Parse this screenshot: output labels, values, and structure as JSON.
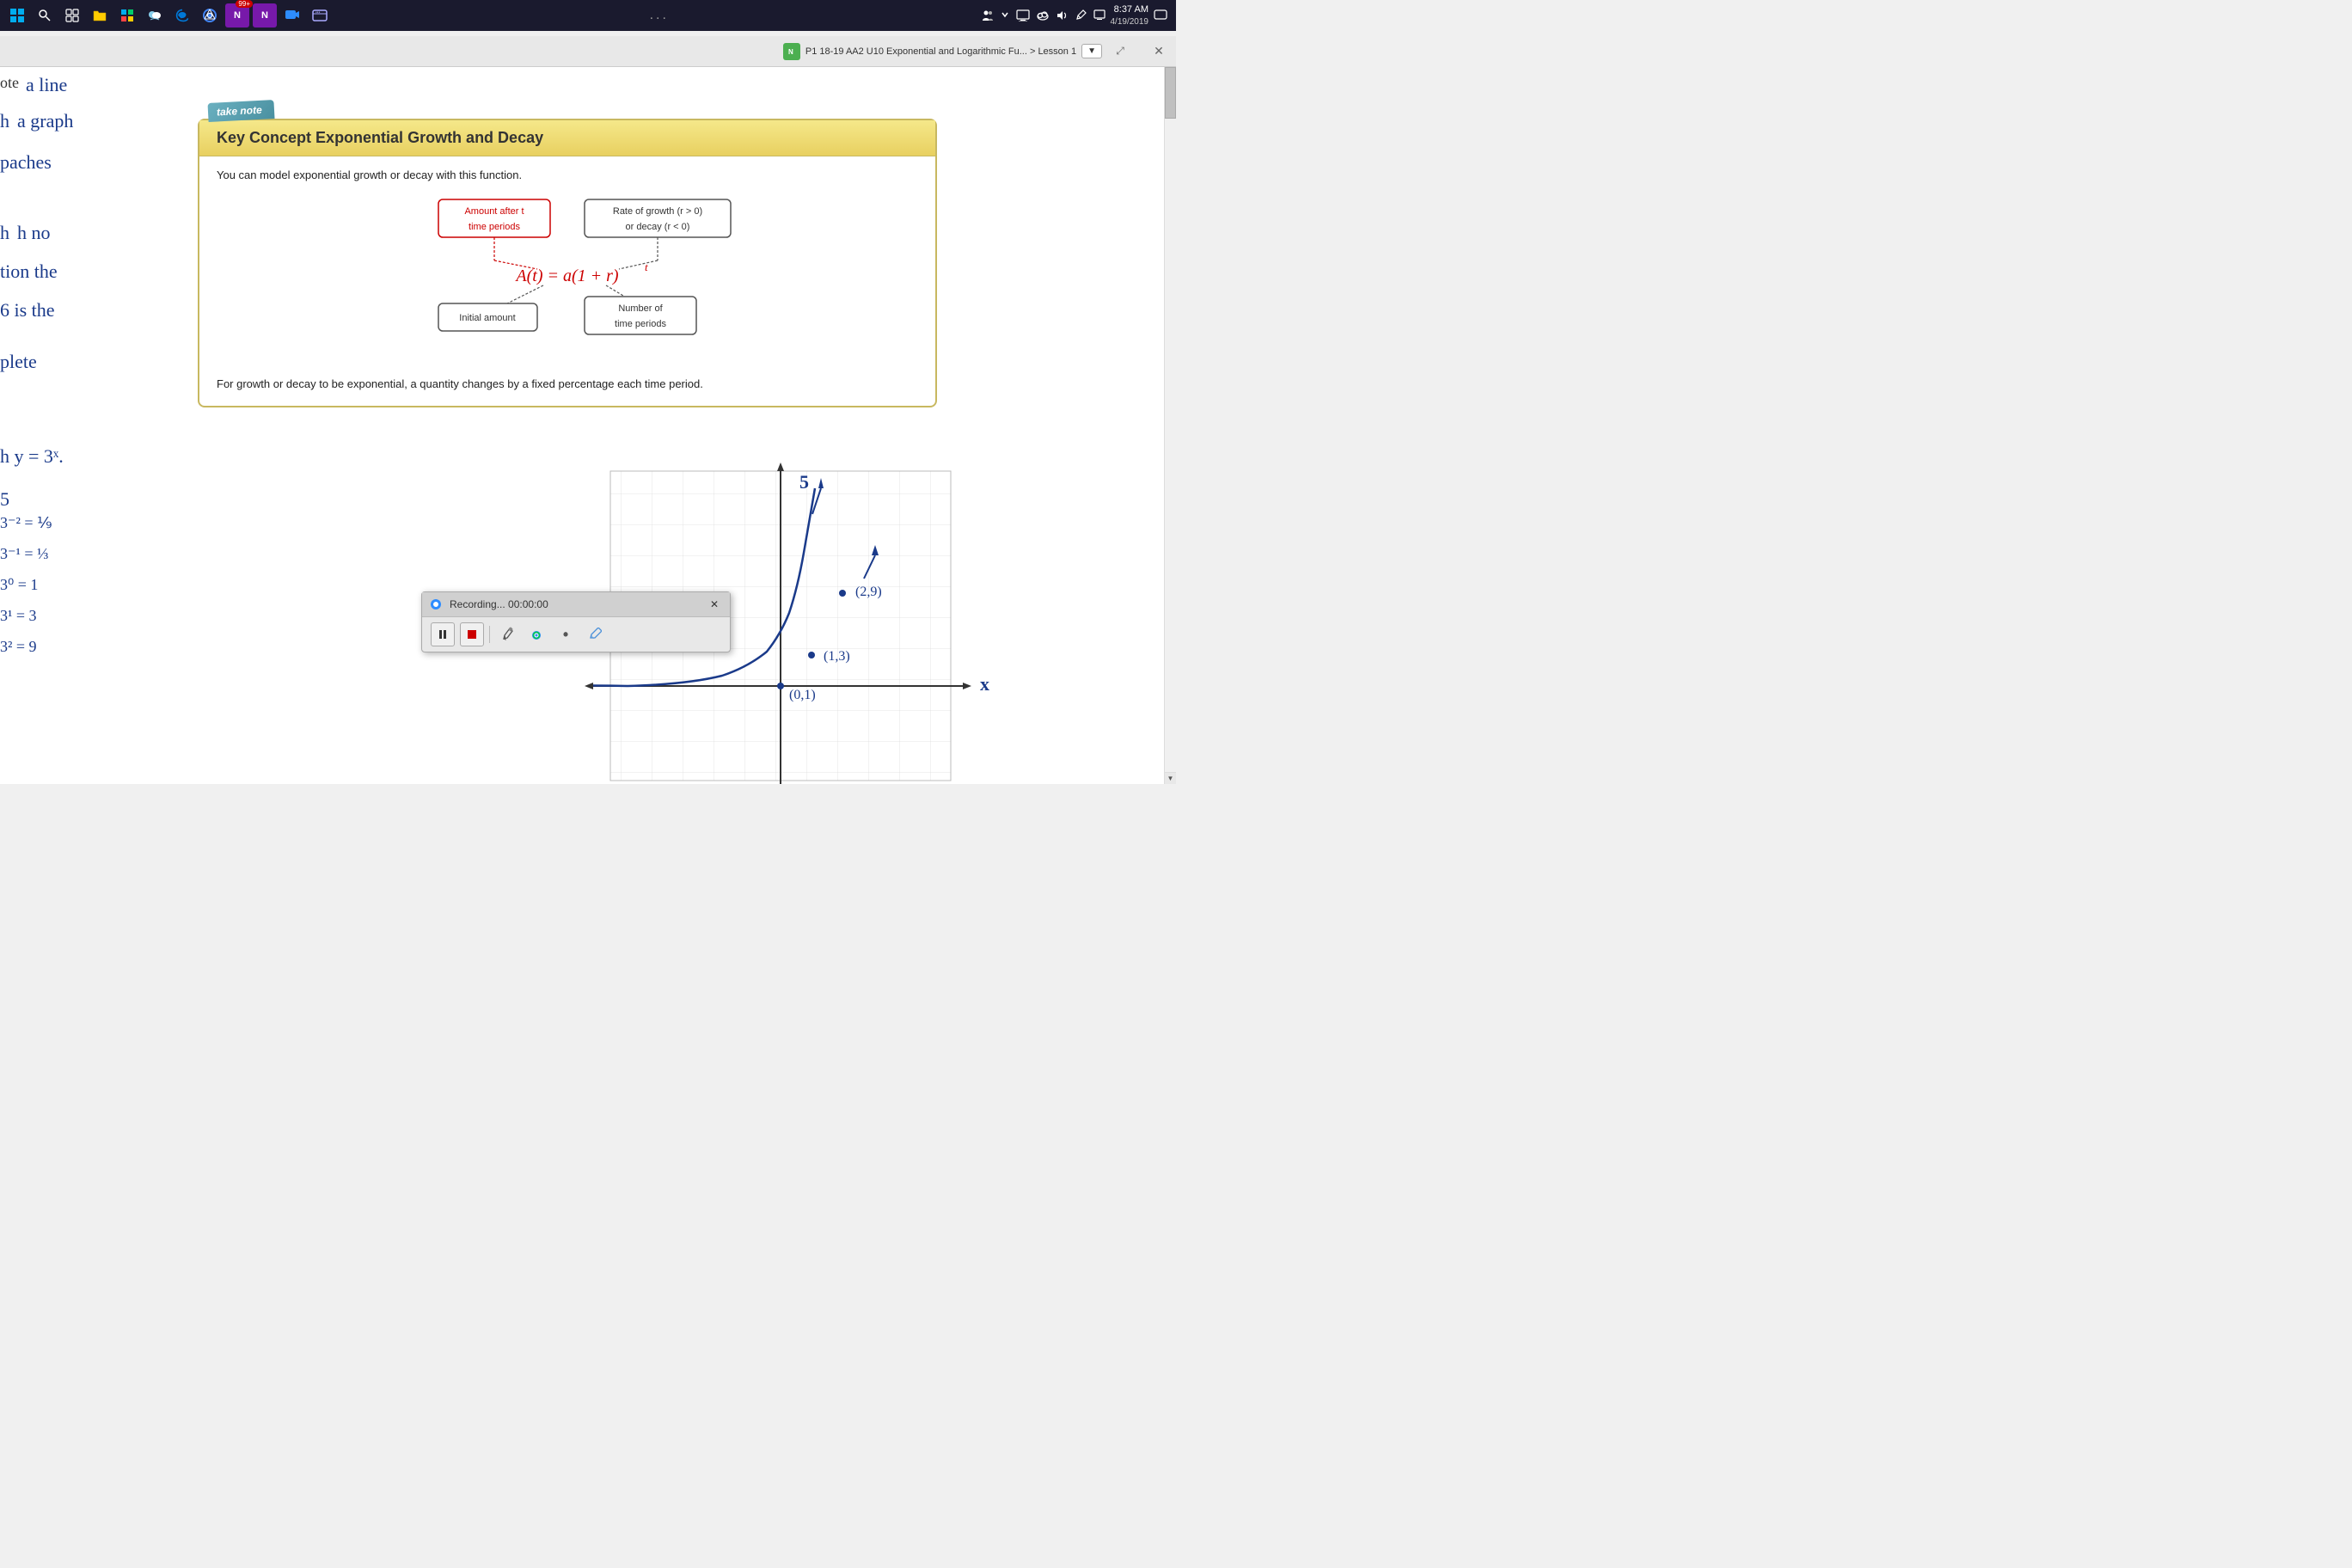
{
  "taskbar": {
    "time": "8:37 AM",
    "date": "4/19/2019",
    "dots": "...",
    "icons": [
      "windows",
      "search",
      "task-view",
      "explorer",
      "store",
      "weather",
      "edge",
      "chrome",
      "onenote-app",
      "onenote",
      "zoom",
      "web"
    ]
  },
  "window": {
    "close_label": "✕",
    "breadcrumb": "P1 18-19 AA2 U10 Exponential and Logarithmic Fu... > Lesson 1",
    "expand_label": "⤢"
  },
  "key_concept": {
    "take_note": "take note",
    "title_bold": "Key Concept",
    "title_rest": "Exponential Growth and Decay",
    "description": "You can model exponential growth or decay with this function.",
    "box1_label": "Amount after t\ntime periods",
    "box2_label": "Rate of growth (r > 0)\nor decay (r < 0)",
    "formula": "A(t) = a(1 + r)ᵗ",
    "box3_label": "Initial amount",
    "box4_label": "Number of\ntime periods",
    "footer": "For growth or decay to be exponential, a quantity changes by a fixed percentage each\ntime period."
  },
  "recording": {
    "title": "Recording... 00:00:00",
    "close": "✕",
    "pause_icon": "⏸",
    "stop_icon": "⏹",
    "icons": [
      "🖊",
      "🔍",
      "•",
      "✏"
    ]
  },
  "handwritten_notes": {
    "line1": "a line",
    "line2": "a graph",
    "line3": "paches",
    "line4": "h no",
    "line5": "tion the",
    "line6": "6 is the",
    "line7": "plete",
    "line8": "h y = 3ˣ.",
    "line9": "3⁻² = ⅑",
    "line10": "3⁻¹ = ⅓",
    "line11": "3⁰ = 1",
    "line12": "3¹ = 3",
    "label_ote": "ote",
    "label_h": "h"
  },
  "graph": {
    "point1": "(0,1)",
    "point2": "(1,3)",
    "point3": "(2,9)",
    "x_label": "x",
    "y_label": "5"
  }
}
